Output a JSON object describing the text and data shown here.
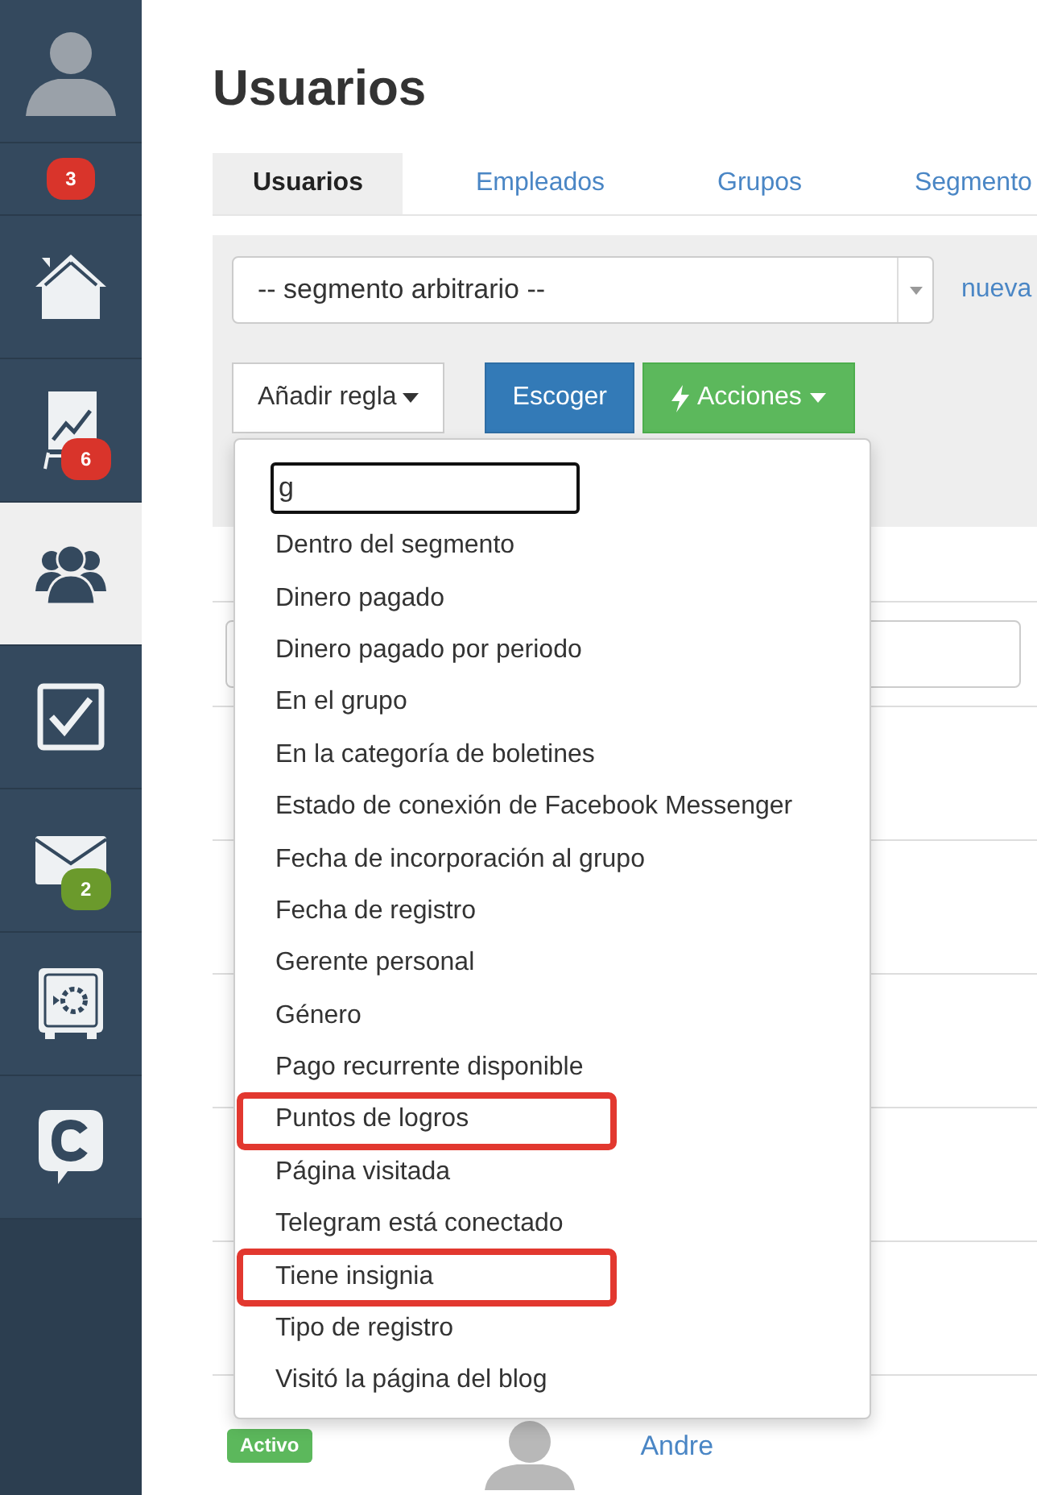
{
  "sidebar": {
    "items": [
      {
        "kind": "profile",
        "selected": false
      },
      {
        "kind": "notifications",
        "selected": false,
        "badge": {
          "text": "3",
          "color": "#d9342b"
        }
      },
      {
        "kind": "home",
        "selected": false
      },
      {
        "kind": "chart",
        "selected": false,
        "badge": {
          "text": "6",
          "color": "#d9342b"
        }
      },
      {
        "kind": "users",
        "selected": true
      },
      {
        "kind": "tasks",
        "selected": false
      },
      {
        "kind": "mail",
        "selected": false,
        "badge": {
          "text": "2",
          "color": "#6b9a2c"
        }
      },
      {
        "kind": "safe",
        "selected": false
      },
      {
        "kind": "chat",
        "selected": false
      }
    ]
  },
  "page": {
    "title": "Usuarios"
  },
  "tabs": [
    {
      "label": "Usuarios",
      "selected": true
    },
    {
      "label": "Empleados",
      "selected": false
    },
    {
      "label": "Grupos",
      "selected": false
    },
    {
      "label": "Segmento",
      "selected": false
    }
  ],
  "filter_panel": {
    "segment_select": {
      "value": "-- segmento arbitrario --"
    },
    "new_link": "nueva",
    "buttons": [
      {
        "label": "Añadir regla",
        "kind": "dropdown"
      },
      {
        "label": "Escoger",
        "kind": "primary"
      },
      {
        "label": "Acciones",
        "kind": "actions"
      }
    ]
  },
  "rule_menu": {
    "search": {
      "value": "g"
    },
    "items": [
      {
        "label": "Dentro del segmento",
        "highlighted": false
      },
      {
        "label": "Dinero pagado",
        "highlighted": false
      },
      {
        "label": "Dinero pagado por periodo",
        "highlighted": false
      },
      {
        "label": "En el grupo",
        "highlighted": false
      },
      {
        "label": "En la categoría de boletines",
        "highlighted": false
      },
      {
        "label": "Estado de conexión de Facebook Messenger",
        "highlighted": false
      },
      {
        "label": "Fecha de incorporación al grupo",
        "highlighted": false
      },
      {
        "label": "Fecha de registro",
        "highlighted": false
      },
      {
        "label": "Gerente personal",
        "highlighted": false
      },
      {
        "label": "Género",
        "highlighted": false
      },
      {
        "label": "Pago recurrente disponible",
        "highlighted": false
      },
      {
        "label": "Puntos de logros",
        "highlighted": true
      },
      {
        "label": "Página visitada",
        "highlighted": false
      },
      {
        "label": "Telegram está conectado",
        "highlighted": false
      },
      {
        "label": "Tiene insignia",
        "highlighted": true
      },
      {
        "label": "Tipo de registro",
        "highlighted": false
      },
      {
        "label": "Visitó la página del blog",
        "highlighted": false
      }
    ]
  },
  "table": {
    "rows": [
      {
        "status": "Activo",
        "name": "Andre"
      }
    ]
  }
}
